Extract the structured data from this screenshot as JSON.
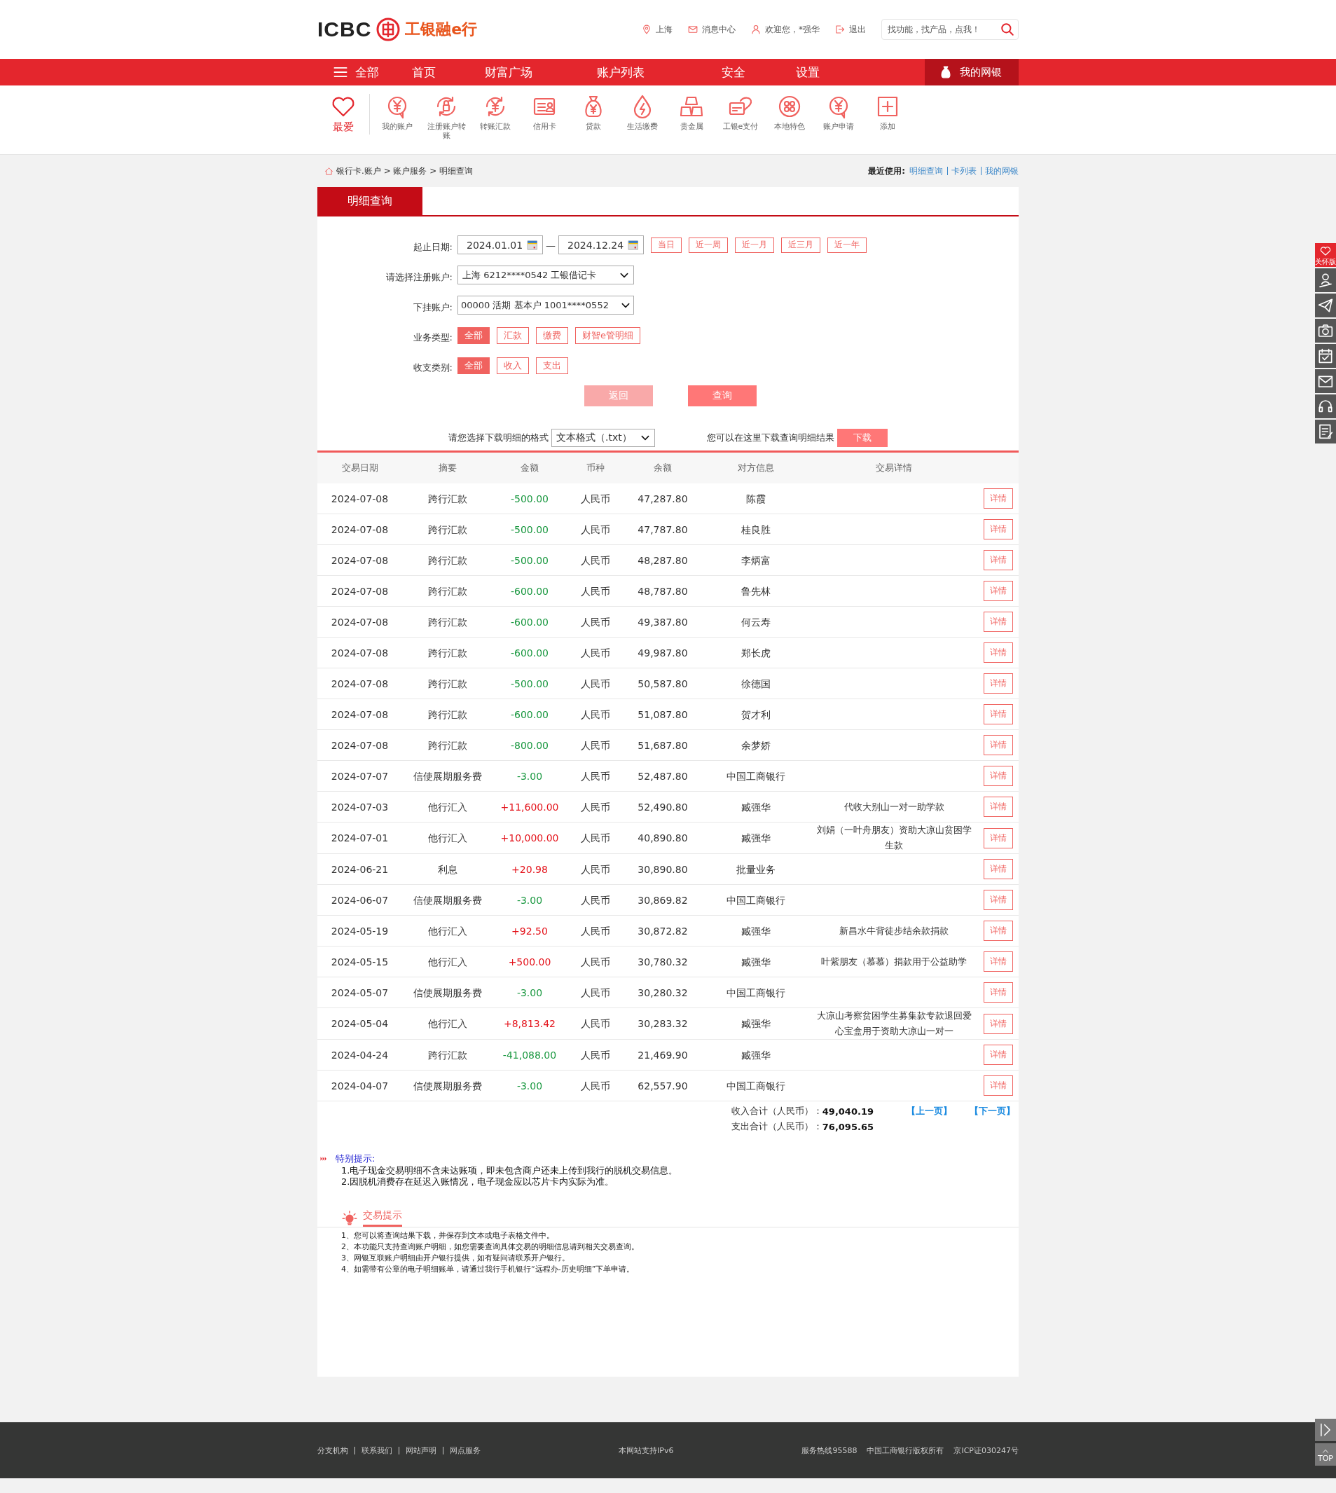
{
  "header": {
    "logo_text": "ICBC",
    "logo_cn": "工银融e行",
    "location": "上海",
    "messages": "消息中心",
    "welcome": "欢迎您，*强华",
    "logout": "退出",
    "search": {
      "placeholder": "找功能，找产品，点我！"
    }
  },
  "nav": {
    "menu_label": "全部",
    "items": [
      "首页",
      "财富广场",
      "账户列表",
      "安全",
      "设置"
    ],
    "my_bank": "我的网银"
  },
  "quick": {
    "favorite": "最爱",
    "items": [
      {
        "label": "我的账户",
        "kind": "yen-bubble"
      },
      {
        "label": "注册账户转账",
        "kind": "cycle-lock"
      },
      {
        "label": "转账汇款",
        "kind": "yen-cycle"
      },
      {
        "label": "信用卡",
        "kind": "card"
      },
      {
        "label": "贷款",
        "kind": "bag"
      },
      {
        "label": "生活缴费",
        "kind": "drop"
      },
      {
        "label": "贵金属",
        "kind": "bars"
      },
      {
        "label": "工银e支付",
        "kind": "epay"
      },
      {
        "label": "本地特色",
        "kind": "dots"
      },
      {
        "label": "账户申请",
        "kind": "yen-bubble"
      },
      {
        "label": "添加",
        "kind": "plus"
      }
    ]
  },
  "breadcrumb": "银行卡.账户 > 账户服务 > 明细查询",
  "recent": {
    "label": "最近使用:",
    "links": [
      "明细查询",
      "卡列表",
      "我的网银"
    ]
  },
  "tab": "明细查询",
  "form": {
    "date": {
      "label": "起止日期:",
      "start": "2024.01.01",
      "dash": "—",
      "end": "2024.12.24",
      "quick_ranges": [
        {
          "label": "当日",
          "selected": false
        },
        {
          "label": "近一周",
          "selected": false
        },
        {
          "label": "近一月",
          "selected": false
        },
        {
          "label": "近三月",
          "selected": false
        },
        {
          "label": "近一年",
          "selected": false
        }
      ]
    },
    "account": {
      "label": "请选择注册账户:",
      "value": "上海 6212****0542 工银借记卡"
    },
    "sub_account": {
      "label": "下挂账户:",
      "value": "00000 活期 基本户 1001****0552"
    },
    "business_type": {
      "label": "业务类型:",
      "options": [
        {
          "label": "全部",
          "selected": true
        },
        {
          "label": "汇款",
          "selected": false
        },
        {
          "label": "缴费",
          "selected": false
        },
        {
          "label": "财智e管明细",
          "selected": false
        }
      ]
    },
    "flow_type": {
      "label": "收支类别:",
      "options": [
        {
          "label": "全部",
          "selected": true
        },
        {
          "label": "收入",
          "selected": false
        },
        {
          "label": "支出",
          "selected": false
        }
      ]
    },
    "buttons": [
      {
        "label": "返回",
        "disabled": true
      },
      {
        "label": "查询",
        "disabled": false
      }
    ]
  },
  "download": {
    "label": "请您选择下载明细的格式",
    "format": "文本格式（.txt）",
    "hint": "您可以在这里下载查询明细结果",
    "button": "下载"
  },
  "table": {
    "columns": [
      "交易日期",
      "摘要",
      "金额",
      "币种",
      "余额",
      "对方信息",
      "交易详情"
    ],
    "rows": [
      {
        "date": "2024-07-08",
        "summary": "跨行汇款",
        "amount": "-500.00",
        "kind": "out",
        "currency": "人民币",
        "balance": "47,287.80",
        "counterparty": "陈霞",
        "action": "详情"
      },
      {
        "date": "2024-07-08",
        "summary": "跨行汇款",
        "amount": "-500.00",
        "kind": "out",
        "currency": "人民币",
        "balance": "47,787.80",
        "counterparty": "桂良胜",
        "action": "详情"
      },
      {
        "date": "2024-07-08",
        "summary": "跨行汇款",
        "amount": "-500.00",
        "kind": "out",
        "currency": "人民币",
        "balance": "48,287.80",
        "counterparty": "李炳富",
        "action": "详情"
      },
      {
        "date": "2024-07-08",
        "summary": "跨行汇款",
        "amount": "-600.00",
        "kind": "out",
        "currency": "人民币",
        "balance": "48,787.80",
        "counterparty": "鲁先林",
        "action": "详情"
      },
      {
        "date": "2024-07-08",
        "summary": "跨行汇款",
        "amount": "-600.00",
        "kind": "out",
        "currency": "人民币",
        "balance": "49,387.80",
        "counterparty": "何云寿",
        "action": "详情"
      },
      {
        "date": "2024-07-08",
        "summary": "跨行汇款",
        "amount": "-600.00",
        "kind": "out",
        "currency": "人民币",
        "balance": "49,987.80",
        "counterparty": "郑长虎",
        "action": "详情"
      },
      {
        "date": "2024-07-08",
        "summary": "跨行汇款",
        "amount": "-500.00",
        "kind": "out",
        "currency": "人民币",
        "balance": "50,587.80",
        "counterparty": "徐德国",
        "action": "详情"
      },
      {
        "date": "2024-07-08",
        "summary": "跨行汇款",
        "amount": "-600.00",
        "kind": "out",
        "currency": "人民币",
        "balance": "51,087.80",
        "counterparty": "贺才利",
        "action": "详情"
      },
      {
        "date": "2024-07-08",
        "summary": "跨行汇款",
        "amount": "-800.00",
        "kind": "out",
        "currency": "人民币",
        "balance": "51,687.80",
        "counterparty": "余梦娇",
        "action": "详情"
      },
      {
        "date": "2024-07-07",
        "summary": "信使展期服务费",
        "amount": "-3.00",
        "kind": "out",
        "currency": "人民币",
        "balance": "52,487.80",
        "counterparty": "中国工商银行",
        "action": "详情"
      },
      {
        "date": "2024-07-03",
        "summary": "他行汇入",
        "amount": "+11,600.00",
        "kind": "in",
        "currency": "人民币",
        "balance": "52,490.80",
        "counterparty": "臧强华",
        "detail": "代收大别山一对一助学款",
        "action": "详情"
      },
      {
        "date": "2024-07-01",
        "summary": "他行汇入",
        "amount": "+10,000.00",
        "kind": "in",
        "currency": "人民币",
        "balance": "40,890.80",
        "counterparty": "臧强华",
        "detail": "刘娟（一叶舟朋友）资助大凉山贫困学生款",
        "action": "详情"
      },
      {
        "date": "2024-06-21",
        "summary": "利息",
        "amount": "+20.98",
        "kind": "in",
        "currency": "人民币",
        "balance": "30,890.80",
        "counterparty": "批量业务",
        "action": "详情"
      },
      {
        "date": "2024-06-07",
        "summary": "信使展期服务费",
        "amount": "-3.00",
        "kind": "out",
        "currency": "人民币",
        "balance": "30,869.82",
        "counterparty": "中国工商银行",
        "action": "详情"
      },
      {
        "date": "2024-05-19",
        "summary": "他行汇入",
        "amount": "+92.50",
        "kind": "in",
        "currency": "人民币",
        "balance": "30,872.82",
        "counterparty": "臧强华",
        "detail": "新昌水牛背徒步结余款捐款",
        "action": "详情"
      },
      {
        "date": "2024-05-15",
        "summary": "他行汇入",
        "amount": "+500.00",
        "kind": "in",
        "currency": "人民币",
        "balance": "30,780.32",
        "counterparty": "臧强华",
        "detail": "叶紫朋友（慕慕）捐款用于公益助学",
        "action": "详情"
      },
      {
        "date": "2024-05-07",
        "summary": "信使展期服务费",
        "amount": "-3.00",
        "kind": "out",
        "currency": "人民币",
        "balance": "30,280.32",
        "counterparty": "中国工商银行",
        "action": "详情"
      },
      {
        "date": "2024-05-04",
        "summary": "他行汇入",
        "amount": "+8,813.42",
        "kind": "in",
        "currency": "人民币",
        "balance": "30,283.32",
        "counterparty": "臧强华",
        "detail": "大凉山考察贫困学生募集款专款退回爱心宝盒用于资助大凉山一对一",
        "action": "详情"
      },
      {
        "date": "2024-04-24",
        "summary": "跨行汇款",
        "amount": "-41,088.00",
        "kind": "out",
        "currency": "人民币",
        "balance": "21,469.90",
        "counterparty": "臧强华",
        "action": "详情"
      },
      {
        "date": "2024-04-07",
        "summary": "信使展期服务费",
        "amount": "-3.00",
        "kind": "out",
        "currency": "人民币",
        "balance": "62,557.90",
        "counterparty": "中国工商银行",
        "action": "详情"
      }
    ]
  },
  "totals": {
    "income_label": "收入合计（人民币）：",
    "income": "49,040.19",
    "expense_label": "支出合计（人民币）：",
    "expense": "76,095.65",
    "prev": "【上一页】",
    "next": "【下一页】"
  },
  "notice": {
    "title": "特别提示:",
    "lines": [
      "1.电子现金交易明细不含未达账项，即未包含商户还未上传到我行的脱机交易信息。",
      "2.因脱机消费存在延迟入账情况，电子现金应以芯片卡内实际为准。"
    ]
  },
  "tips": {
    "title": "交易提示",
    "lines": [
      "1、您可以将查询结果下载，并保存到文本或电子表格文件中。",
      "2、本功能只支持查询账户明细，如您需要查询具体交易的明细信息请到相关交易查询。",
      "3、网银互联账户明细由开户银行提供，如有疑问请联系开户银行。",
      "4、如需带有公章的电子明细账单，请通过我行手机银行“远程办-历史明细”下单申请。"
    ]
  },
  "footer": {
    "links": [
      "分支机构",
      "联系我们",
      "网站声明",
      "网点服务"
    ],
    "ipv6": "本网站支持IPv6",
    "hotline": "服务热线95588",
    "copyright": "中国工商银行版权所有",
    "icp": "京ICP证030247号"
  },
  "side_tools": [
    {
      "kind": "care",
      "label": "关怀版"
    },
    {
      "kind": "person"
    },
    {
      "kind": "plane"
    },
    {
      "kind": "camera"
    },
    {
      "kind": "calendar"
    },
    {
      "kind": "mail"
    },
    {
      "kind": "headset"
    },
    {
      "kind": "notepad"
    }
  ],
  "corner": {
    "top": "TOP"
  }
}
